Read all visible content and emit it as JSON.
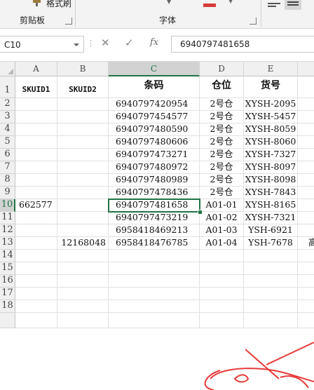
{
  "ribbon": {
    "format_painter": "格式刷",
    "clipboard_group": "剪贴板",
    "font_group": "字体"
  },
  "formula_bar": {
    "name_box": "C10",
    "fx_label": "fx",
    "formula_value": "6940797481658"
  },
  "columns": [
    "A",
    "B",
    "C",
    "D",
    "E"
  ],
  "rows": [
    "1",
    "2",
    "3",
    "4",
    "5",
    "6",
    "7",
    "8",
    "9",
    "10",
    "11",
    "12",
    "13",
    "14",
    "15",
    "16",
    "17",
    "18"
  ],
  "cells": {
    "r1": {
      "A": "SKUID1",
      "B": "SKUID2",
      "C": "条码",
      "D": "仓位",
      "E": "货号"
    },
    "r2": {
      "C": "6940797420954",
      "D": "2号仓",
      "E": "XYSH-2095"
    },
    "r3": {
      "C": "6940797454577",
      "D": "2号仓",
      "E": "XYSH-5457"
    },
    "r4": {
      "C": "6940797480590",
      "D": "2号仓",
      "E": "XYSH-8059"
    },
    "r5": {
      "C": "6940797480606",
      "D": "2号仓",
      "E": "XYSH-8060"
    },
    "r6": {
      "C": "6940797473271",
      "D": "2号仓",
      "E": "XYSH-7327"
    },
    "r7": {
      "C": "6940797480972",
      "D": "2号仓",
      "E": "XYSH-8097"
    },
    "r8": {
      "C": "6940797480989",
      "D": "2号仓",
      "E": "XYSH-8098"
    },
    "r9": {
      "C": "6940797478436",
      "D": "2号仓",
      "E": "XYSH-7843"
    },
    "r10": {
      "A": "662577",
      "C": "6940797481658",
      "D": "A01-01",
      "E": "XYSH-8165"
    },
    "r11": {
      "C": "6940797473219",
      "D": "A01-02",
      "E": "XYSH-7321"
    },
    "r12": {
      "C": "6958418469213",
      "D": "A01-03",
      "E": "YSH-6921"
    },
    "r13": {
      "B": "12168048",
      "C": "6958418476785",
      "D": "A01-04",
      "E": "YSH-7678",
      "F": "高"
    }
  },
  "selected_cell": "C10",
  "colors": {
    "accent": "#217346",
    "annotation": "#e83a3a"
  }
}
